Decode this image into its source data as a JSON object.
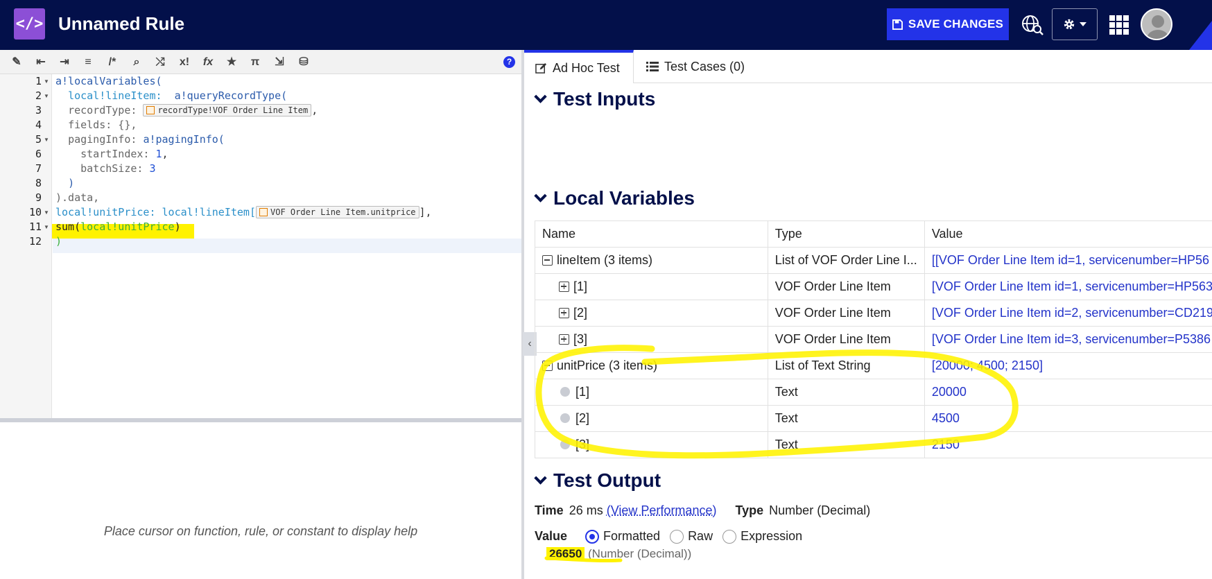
{
  "header": {
    "logo_glyph": "</>",
    "title": "Unnamed Rule",
    "save_label": "SAVE CHANGES"
  },
  "editor": {
    "line_numbers": [
      "1",
      "2",
      "3",
      "4",
      "5",
      "6",
      "7",
      "8",
      "9",
      "10",
      "11",
      "12"
    ],
    "code": {
      "l1": "a!localVariables(",
      "l2_var": "local!lineItem:",
      "l2_fn": "a!queryRecordType(",
      "l3_key": "recordType:",
      "l3_chip": "recordType!VOF Order Line Item",
      "l3_end": ",",
      "l4": "fields: {},",
      "l5_key": "pagingInfo:",
      "l5_fn": "a!pagingInfo(",
      "l6_key": "startIndex:",
      "l6_val": "1",
      "l6_end": ",",
      "l7_key": "batchSize:",
      "l7_val": "3",
      "l8": ")",
      "l9": ").data,",
      "l10_var": "local!unitPrice:",
      "l10_ref": "local!lineItem[",
      "l10_chip": "VOF Order Line Item.unitprice",
      "l10_end": "],",
      "l11_fn": "sum(",
      "l11_arg": "local!unitPrice",
      "l11_end": ")",
      "l12": ")"
    },
    "help_placeholder": "Place cursor on function, rule, or constant to display help"
  },
  "tabs": {
    "adhoc": "Ad Hoc Test",
    "testcases": "Test Cases (0)"
  },
  "sections": {
    "inputs": "Test Inputs",
    "locals": "Local Variables",
    "output": "Test Output"
  },
  "locals_table": {
    "headers": [
      "Name",
      "Type",
      "Value"
    ],
    "rows": [
      {
        "name": "lineItem (3 items)",
        "type": "List of VOF Order Line I...",
        "value": "[[VOF Order Line Item id=1, servicenumber=HP56"
      },
      {
        "name": "[1]",
        "type": "VOF Order Line Item",
        "value": "[VOF Order Line Item id=1, servicenumber=HP563"
      },
      {
        "name": "[2]",
        "type": "VOF Order Line Item",
        "value": "[VOF Order Line Item id=2, servicenumber=CD219"
      },
      {
        "name": "[3]",
        "type": "VOF Order Line Item",
        "value": "[VOF Order Line Item id=3, servicenumber=P5386"
      },
      {
        "name": "unitPrice (3 items)",
        "type": "List of Text String",
        "value": "[20000; 4500; 2150]"
      },
      {
        "name": "[1]",
        "type": "Text",
        "value": "20000"
      },
      {
        "name": "[2]",
        "type": "Text",
        "value": "4500"
      },
      {
        "name": "[3]",
        "type": "Text",
        "value": "2150"
      }
    ]
  },
  "output": {
    "time_label": "Time",
    "time_value": "26 ms",
    "perf_link": "(View Performance)",
    "type_label": "Type",
    "type_value": "Number (Decimal)",
    "value_label": "Value",
    "formats": [
      "Formatted",
      "Raw",
      "Expression"
    ],
    "selected_format": "Formatted",
    "result": "26650",
    "result_type": "(Number (Decimal))"
  },
  "colors": {
    "topbar": "#03104a",
    "accent": "#2333e8",
    "logo": "#8c4fd6",
    "highlight": "#fff200"
  }
}
